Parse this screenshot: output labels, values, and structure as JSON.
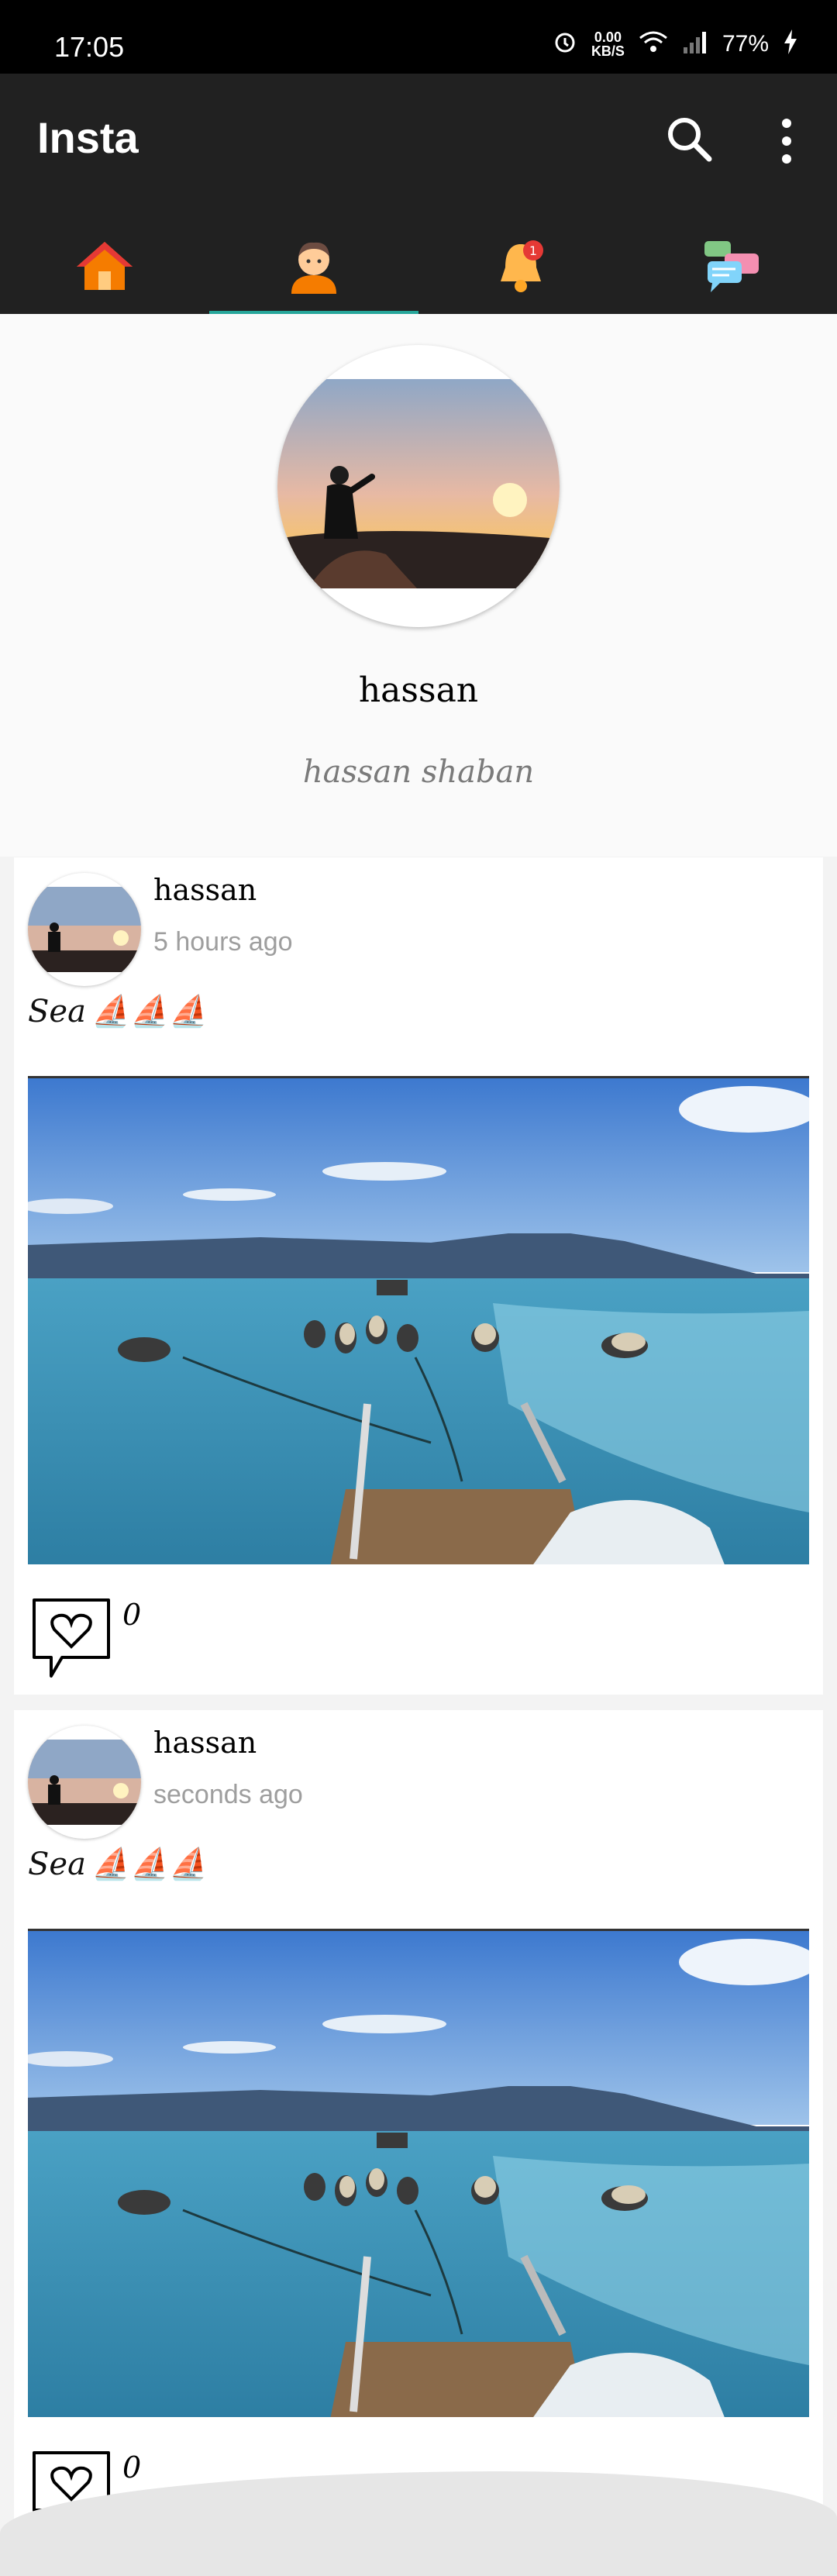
{
  "status_bar": {
    "time": "17:05",
    "net_speed": "0.00",
    "net_unit": "KB/S",
    "battery": "77%"
  },
  "app_bar": {
    "title": "Insta",
    "icons": [
      "search-icon",
      "more-vert-icon"
    ]
  },
  "tabs": [
    {
      "name": "home",
      "icon": "home-icon"
    },
    {
      "name": "profile",
      "icon": "person-icon",
      "selected": true
    },
    {
      "name": "notifications",
      "icon": "bell-icon",
      "badge": "1"
    },
    {
      "name": "messages",
      "icon": "chat-icon"
    }
  ],
  "profile": {
    "username": "hassan",
    "full_name": "hassan shaban"
  },
  "posts": [
    {
      "user": "hassan",
      "time": "5 hours ago",
      "caption": "Sea",
      "caption_emoji": "⛵⛵⛵",
      "likes": "0"
    },
    {
      "user": "hassan",
      "time": "seconds ago",
      "caption": "Sea",
      "caption_emoji": "⛵⛵⛵",
      "likes": "0"
    }
  ],
  "colors": {
    "app_bar": "#212121",
    "tab_indicator": "#26a69a",
    "badge": "#e53935"
  }
}
